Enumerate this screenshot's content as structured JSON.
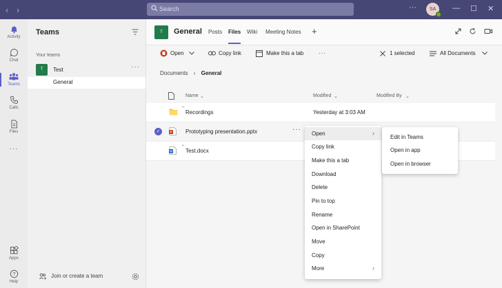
{
  "titlebar": {
    "back": "‹",
    "forward": "›",
    "search_placeholder": "Search",
    "avatar_initials": "SA",
    "more": "···",
    "minimize": "—",
    "maximize": "☐",
    "close": "✕"
  },
  "rail": {
    "items": [
      {
        "label": "Activity",
        "icon": "bell-icon"
      },
      {
        "label": "Chat",
        "icon": "chat-icon"
      },
      {
        "label": "Teams",
        "icon": "teams-icon"
      },
      {
        "label": "Calls",
        "icon": "phone-icon"
      },
      {
        "label": "Files",
        "icon": "file-icon"
      },
      {
        "label": "Apps",
        "icon": "apps-icon"
      },
      {
        "label": "Help",
        "icon": "help-icon"
      }
    ],
    "more": "···"
  },
  "teams_panel": {
    "title": "Teams",
    "section": "Your teams",
    "team_tile": "T",
    "team_name": "Test",
    "team_more": "···",
    "channel": "General",
    "join": "Join or create a team"
  },
  "header": {
    "tile": "T",
    "title": "General",
    "tabs": [
      "Posts",
      "Files",
      "Wiki",
      "Meeting Notes"
    ],
    "add_tab": "+"
  },
  "toolbar": {
    "open": "Open",
    "copy_link": "Copy link",
    "make_tab": "Make this a tab",
    "more": "···",
    "selected": "1 selected",
    "view": "All Documents"
  },
  "breadcrumb": {
    "root": "Documents",
    "current": "General"
  },
  "table": {
    "columns": [
      "Name",
      "Modified",
      "Modified By"
    ],
    "rows": [
      {
        "name": "Recordings",
        "modified": "Yesterday at 3:03 AM",
        "type": "folder"
      },
      {
        "name": "Prototyping presentation.pptx",
        "modified": "",
        "type": "pptx"
      },
      {
        "name": "Test.docx",
        "modified": "",
        "type": "docx"
      }
    ],
    "row_more": "···"
  },
  "context_menu": {
    "items": [
      "Open",
      "Copy link",
      "Make this a tab",
      "Download",
      "Delete",
      "Pin to top",
      "Rename",
      "Open in SharePoint",
      "Move",
      "Copy",
      "More"
    ]
  },
  "submenu": {
    "items": [
      "Edit in Teams",
      "Open in app",
      "Open in browser"
    ]
  },
  "colors": {
    "titlebar": "#464775",
    "accent": "#5b5fc7",
    "team_tile": "#237b4b"
  }
}
